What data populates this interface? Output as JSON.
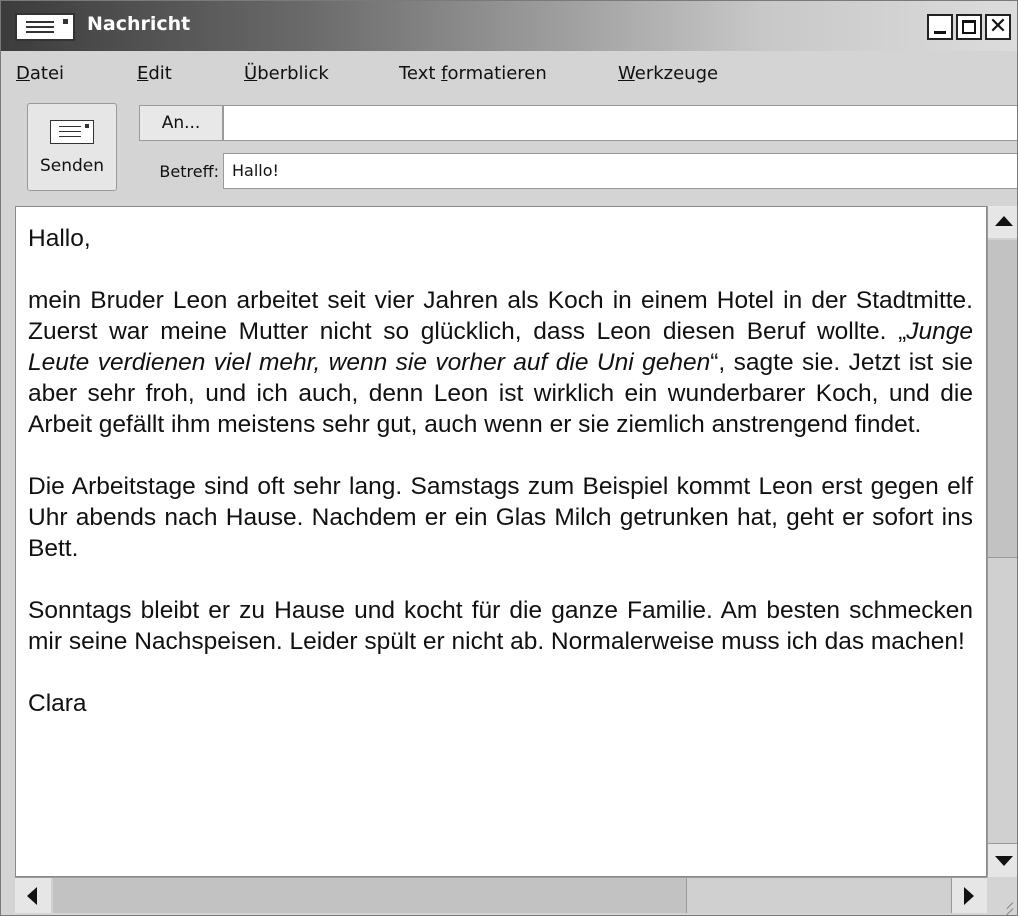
{
  "window": {
    "title": "Nachricht"
  },
  "menu": {
    "items": [
      {
        "mnemonic": "D",
        "rest": "atei"
      },
      {
        "mnemonic": "E",
        "rest": "dit"
      },
      {
        "mnemonic": "Ü",
        "rest": "berblick"
      },
      {
        "prefix": "Text ",
        "mnemonic": "f",
        "rest": "ormatieren"
      },
      {
        "mnemonic": "W",
        "rest": "erkzeuge"
      }
    ]
  },
  "toolbar": {
    "send_label": "Senden",
    "to_button": "An...",
    "to_value": "",
    "subject_label": "Betreff:",
    "subject_value": "Hallo!"
  },
  "message": {
    "greeting": "Hallo,",
    "p1_start": "mein Bruder Leon arbeitet seit vier Jahren als Koch in einem Hotel in der Stadtmitte. Zuerst war meine Mutter nicht so glücklich, dass Leon diesen Beruf wollte. „",
    "p1_quote": "Junge Leute verdienen viel mehr, wenn sie vorher auf die Uni gehen",
    "p1_end": "“, sagte sie. Jetzt ist sie aber sehr froh, und ich auch, denn Leon ist wirklich ein wunderbarer Koch, und die Arbeit gefällt ihm meistens sehr gut, auch wenn er sie ziemlich anstrengend findet.",
    "p2": "Die Arbeitstage sind oft sehr lang. Samstags zum Beispiel kommt Leon erst gegen elf Uhr abends nach Hause. Nachdem er ein Glas Milch getrunken hat, geht er sofort ins Bett.",
    "p3": "Sonntags bleibt er zu Hause und kocht für die ganze Familie. Am besten schmecken mir seine Nachspeisen. Leider spült er nicht ab. Normalerweise muss ich das machen!",
    "signature": "Clara"
  },
  "icons": {
    "window": "envelope-icon",
    "send": "envelope-icon",
    "close": "close-icon",
    "minimize": "minimize-icon",
    "maximize": "maximize-icon"
  },
  "colors": {
    "title_gradient_start": "#3c3c3c",
    "title_gradient_end": "#dcdcdc",
    "chrome": "#d4d4d4"
  }
}
